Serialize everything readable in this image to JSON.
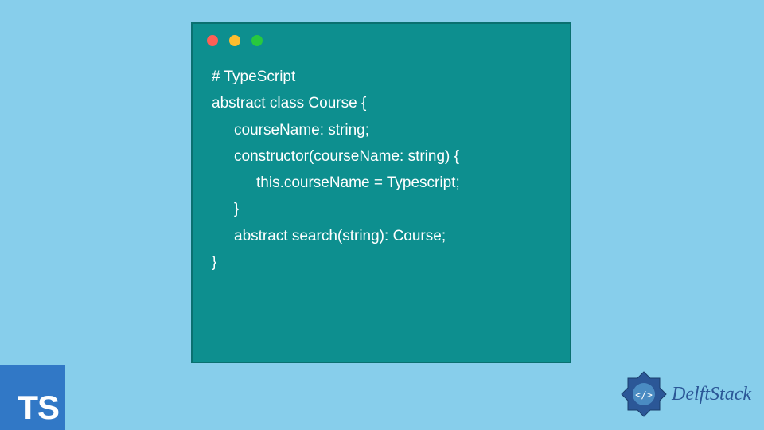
{
  "code": {
    "lines": [
      {
        "text": "# TypeScript",
        "indent": 0
      },
      {
        "text": "abstract class Course {",
        "indent": 0
      },
      {
        "text": "courseName: string;",
        "indent": 1
      },
      {
        "text": "",
        "indent": 0
      },
      {
        "text": "constructor(courseName: string) {",
        "indent": 1
      },
      {
        "text": "this.courseName = Typescript;",
        "indent": 2
      },
      {
        "text": "}",
        "indent": 1
      },
      {
        "text": "",
        "indent": 0
      },
      {
        "text": "abstract search(string): Course;",
        "indent": 1
      },
      {
        "text": "}",
        "indent": 0
      }
    ]
  },
  "ts_badge": "TS",
  "brand": "DelftStack",
  "colors": {
    "background": "#87CEEB",
    "window": "#0d8f8f",
    "ts_badge": "#3178c6",
    "brand": "#2b5797"
  }
}
